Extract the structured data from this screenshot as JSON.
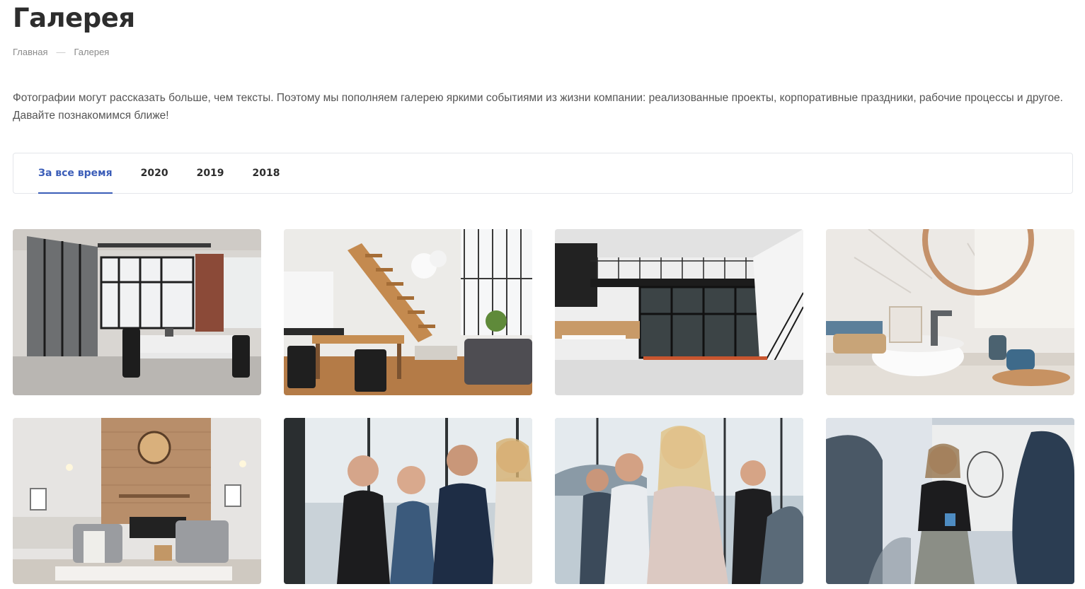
{
  "page": {
    "title": "Галерея",
    "intro": "Фотографии могут рассказать больше, чем тексты. Поэтому мы пополняем галерею яркими событиями из жизни компании: реализованные проекты, корпоративные праздники, рабочие процессы и другое. Давайте познакомимся ближе!"
  },
  "breadcrumb": {
    "home": "Главная",
    "separator": "—",
    "current": "Галерея"
  },
  "tabs": [
    {
      "label": "За все время",
      "active": true
    },
    {
      "label": "2020",
      "active": false
    },
    {
      "label": "2019",
      "active": false
    },
    {
      "label": "2018",
      "active": false
    }
  ],
  "colors": {
    "accent": "#3b5db8",
    "title": "#2d2d2d",
    "text": "#555555",
    "muted": "#8a8a8a",
    "border": "#e4e6ea"
  },
  "gallery": [
    {
      "subject": "office-loft-glass-partitions"
    },
    {
      "subject": "loft-living-room-staircase"
    },
    {
      "subject": "office-mezzanine-glass"
    },
    {
      "subject": "bathroom-sink-mirror"
    },
    {
      "subject": "living-room-wood-wall"
    },
    {
      "subject": "team-smiling-group"
    },
    {
      "subject": "audience-applauding"
    },
    {
      "subject": "woman-presenting"
    }
  ]
}
